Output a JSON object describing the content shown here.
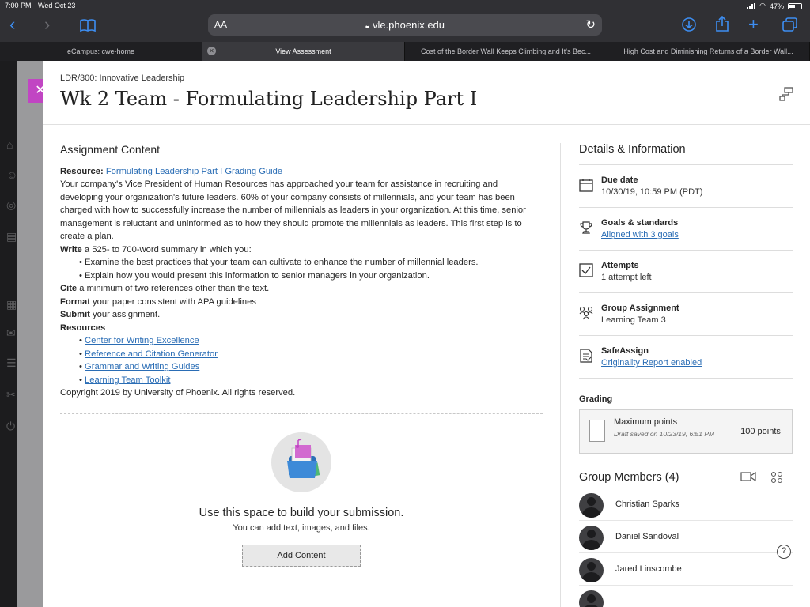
{
  "status": {
    "time": "7:00 PM",
    "date": "Wed Oct 23",
    "battery": "47%"
  },
  "browser": {
    "aa_label": "AA",
    "host": "vle.phoenix.edu",
    "tabs": [
      {
        "label": "eCampus: cwe-home"
      },
      {
        "label": "View Assessment"
      },
      {
        "label": "Cost of the Border Wall Keeps Climbing and It's Bec..."
      },
      {
        "label": "High Cost and Diminishing Returns of a Border Wall..."
      }
    ]
  },
  "header": {
    "course": "LDR/300: Innovative Leadership",
    "title": "Wk 2 Team - Formulating Leadership Part I"
  },
  "assignment": {
    "heading": "Assignment Content",
    "resource_label": "Resource:",
    "resource_link": "Formulating Leadership Part I Grading Guide",
    "intro": "Your company's Vice President of Human Resources has approached your team for assistance in recruiting and developing your organization's future leaders. 60% of your company consists of millennials, and your team has been charged with how to successfully increase the number of millennials as leaders in your organization. At this time, senior management is reluctant and uninformed as to how they should promote the millennials as leaders. This first step is to create a plan.",
    "write_label": "Write",
    "write_text": " a 525- to 700-word summary in which you:",
    "bullets": [
      "Examine the best practices that your team can cultivate to enhance the number of millennial leaders.",
      "Explain how you would present this information to senior managers in your organization."
    ],
    "cite_label": "Cite",
    "cite_text": " a minimum of two references other than the text.",
    "format_label": "Format",
    "format_text": " your paper consistent with APA guidelines",
    "submit_label": "Submit",
    "submit_text": " your assignment.",
    "resources_label": "Resources",
    "resources": [
      "Center for Writing Excellence",
      "Reference and Citation Generator",
      "Grammar and Writing Guides",
      "Learning Team Toolkit"
    ],
    "copyright": "Copyright 2019 by University of Phoenix. All rights reserved."
  },
  "submission": {
    "title": "Use this space to build your submission.",
    "subtitle": "You can add text, images, and files.",
    "button": "Add Content"
  },
  "details": {
    "heading": "Details & Information",
    "due_label": "Due date",
    "due_value": "10/30/19, 10:59 PM (PDT)",
    "goals_label": "Goals & standards",
    "goals_link": "Aligned with 3 goals",
    "attempts_label": "Attempts",
    "attempts_value": "1 attempt left",
    "group_label": "Group Assignment",
    "group_value": "Learning Team 3",
    "safeassign_label": "SafeAssign",
    "safeassign_link": "Originality Report enabled",
    "grading_label": "Grading",
    "max_points_label": "Maximum points",
    "draft_note": "Draft saved on 10/23/19, 6:51 PM",
    "points": "100 points"
  },
  "members": {
    "heading": "Group Members (4)",
    "list": [
      "Christian Sparks",
      "Daniel Sandoval",
      "Jared Linscombe"
    ]
  },
  "colors": {
    "accent": "#c145c3",
    "link": "#2a6db5",
    "safari_blue": "#3d8ef2"
  }
}
